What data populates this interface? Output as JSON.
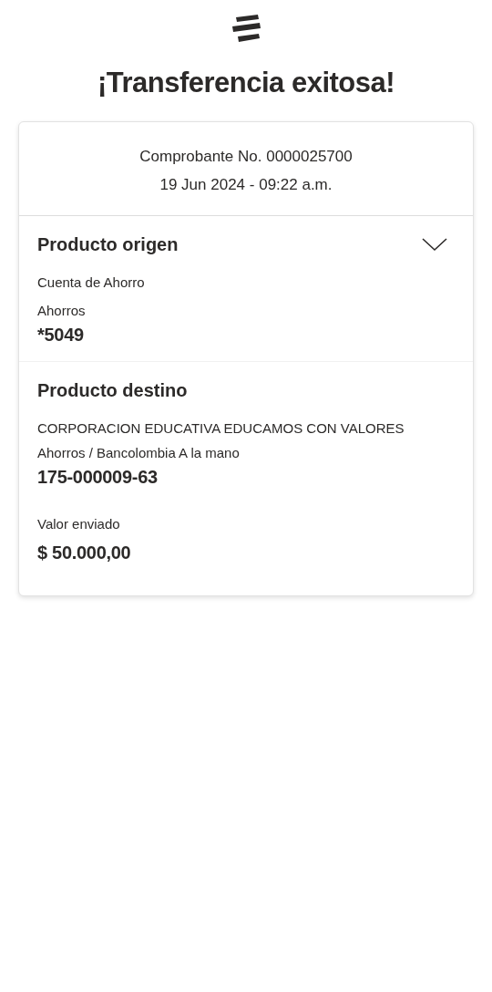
{
  "title": "¡Transferencia exitosa!",
  "receipt": {
    "number": "Comprobante No. 0000025700",
    "datetime": "19 Jun 2024 - 09:22 a.m."
  },
  "origin": {
    "heading": "Producto origen",
    "product": "Cuenta de Ahorro",
    "type": "Ahorros",
    "account": "*5049"
  },
  "destination": {
    "heading": "Producto destino",
    "holder": "CORPORACION EDUCATIVA EDUCAMOS CON VALORES",
    "type": "Ahorros / Bancolombia A la mano",
    "account": "175-000009-63",
    "amount_label": "Valor enviado",
    "amount": "$ 50.000,00"
  }
}
